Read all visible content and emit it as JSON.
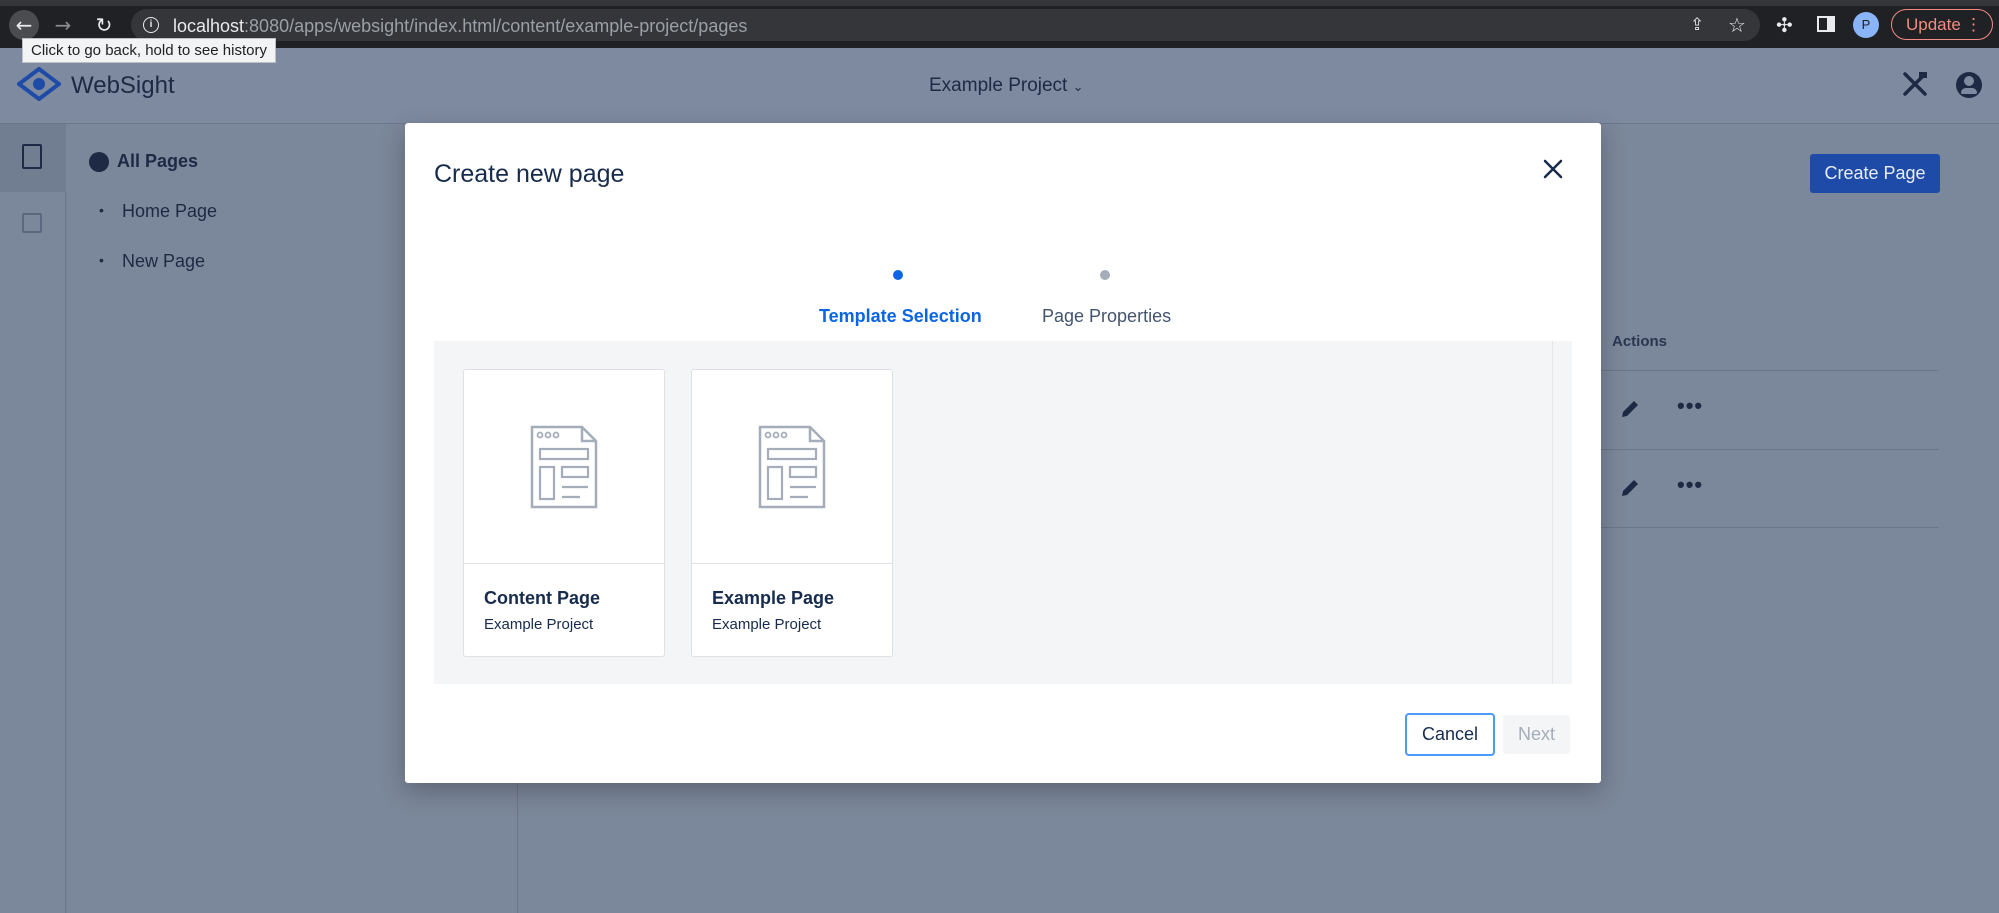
{
  "browser": {
    "url_host": "localhost",
    "url_rest": ":8080/apps/websight/index.html/content/example-project/pages",
    "tooltip": "Click to go back, hold to see history",
    "profile_initial": "P",
    "update_label": "Update"
  },
  "header": {
    "brand": "WebSight",
    "project": "Example Project"
  },
  "tree": {
    "root": "All Pages",
    "items": [
      {
        "label": "Home Page"
      },
      {
        "label": "New Page"
      }
    ]
  },
  "page": {
    "create_page_label": "Create Page",
    "actions_header": "Actions"
  },
  "modal": {
    "title": "Create new page",
    "steps": [
      {
        "label": "Template Selection",
        "active": true
      },
      {
        "label": "Page Properties",
        "active": false
      }
    ],
    "templates": [
      {
        "name": "Content Page",
        "project": "Example Project"
      },
      {
        "name": "Example Page",
        "project": "Example Project"
      }
    ],
    "cancel_label": "Cancel",
    "next_label": "Next"
  },
  "colors": {
    "accent": "#0c66e4",
    "overlay": "#7b879a",
    "primary_button": "#1e4ba8"
  }
}
